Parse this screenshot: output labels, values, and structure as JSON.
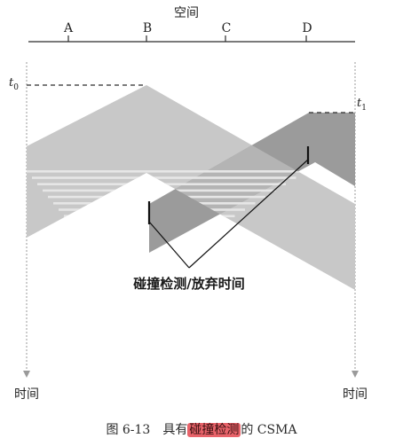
{
  "diagram": {
    "space_label": "空间",
    "stations": [
      "A",
      "B",
      "C",
      "D"
    ],
    "t0_label": "t",
    "t0_sub": "0",
    "t1_label": "t",
    "t1_sub": "1",
    "time_label_left": "时间",
    "time_label_right": "时间",
    "annotation": "碰撞检测/放弃时间"
  },
  "caption": {
    "prefix": "图 6-13　具有",
    "highlight": "碰撞检测",
    "suffix": "的 CSMA"
  },
  "colors": {
    "frame_b": "#c8c8c8",
    "frame_d": "#9b9b9b",
    "overlap": "#b0b0b0",
    "stripes": "#e6e6e6",
    "axis": "#2b2b2b",
    "highlight": "#e8636a"
  }
}
